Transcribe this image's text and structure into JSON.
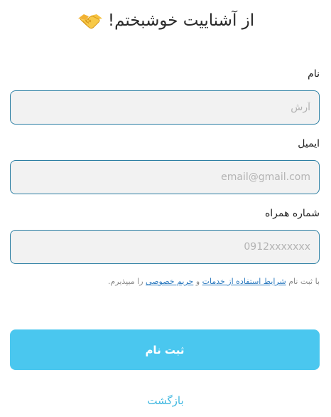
{
  "header": {
    "title": "از آشناییت خوشبختم!",
    "icon": "handshake-icon"
  },
  "form": {
    "name": {
      "label": "نام",
      "placeholder": "آرش",
      "value": ""
    },
    "email": {
      "label": "ایمیل",
      "placeholder": "email@gmail.com",
      "value": ""
    },
    "phone": {
      "label": "شماره همراه",
      "placeholder": "0912xxxxxxx",
      "value": ""
    }
  },
  "terms": {
    "prefix": "با ثبت نام",
    "terms_link": "شرایط استفاده از خدمات",
    "and": "و",
    "privacy_link": "حریم خصوصی",
    "suffix": "را میپذیرم."
  },
  "actions": {
    "submit_label": "ثبت نام",
    "back_label": "بازگشت"
  },
  "colors": {
    "accent": "#4ac7ef",
    "field_border": "#2c7fa3",
    "link": "#2f7cc0"
  }
}
